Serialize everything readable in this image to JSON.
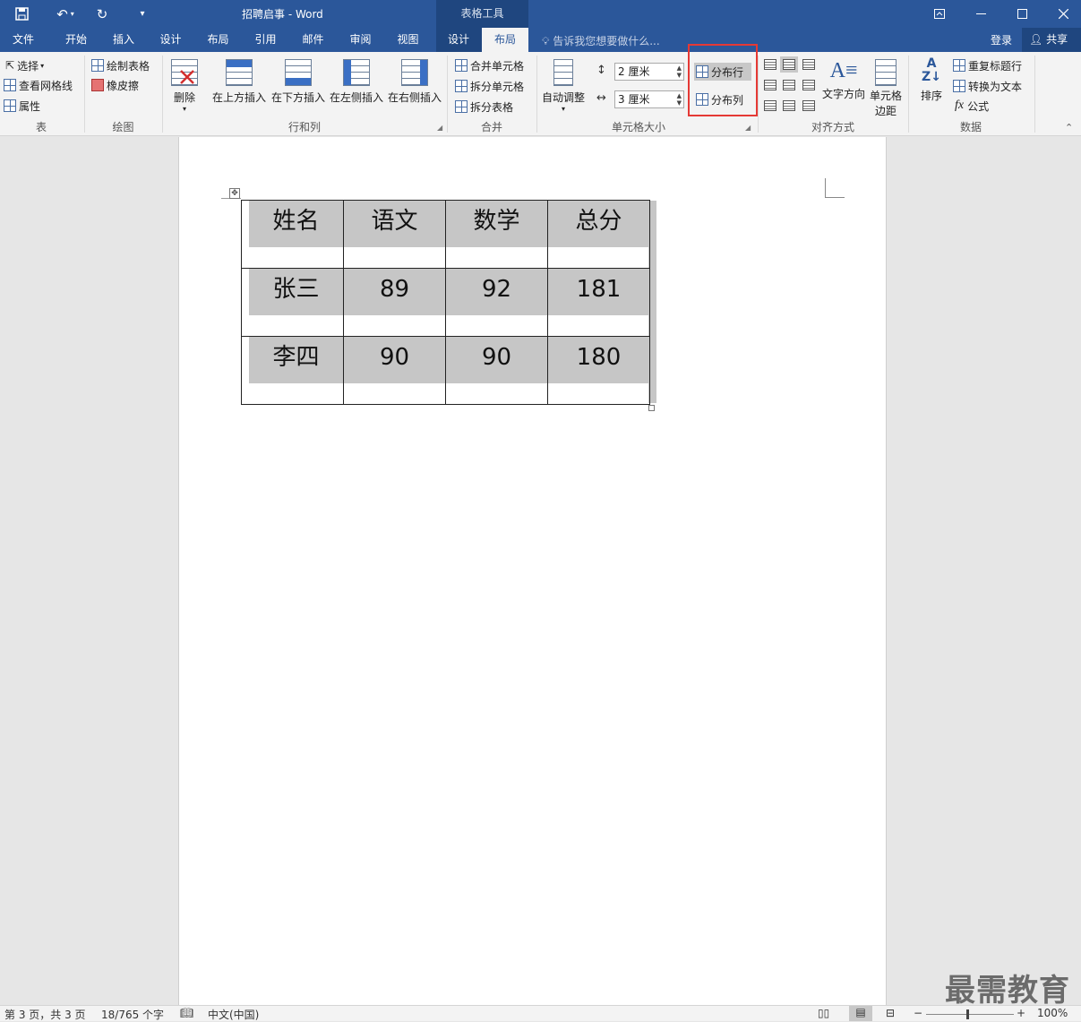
{
  "titlebar": {
    "doc_title": "招聘启事 - Word",
    "table_tools": "表格工具",
    "save_icon": "save-icon",
    "undo_icon": "undo-icon",
    "redo_icon": "redo-icon",
    "customize_icon": "customize-qat-icon"
  },
  "tabs": [
    "文件",
    "开始",
    "插入",
    "设计",
    "布局",
    "引用",
    "邮件",
    "审阅",
    "视图"
  ],
  "tool_tabs": [
    "设计",
    "布局"
  ],
  "tell_me": "告诉我您想要做什么...",
  "account": {
    "login": "登录",
    "share": "共享"
  },
  "ribbon": {
    "table": {
      "select": "选择",
      "gridlines": "查看网格线",
      "properties": "属性",
      "label": "表"
    },
    "draw": {
      "draw_table": "绘制表格",
      "eraser": "橡皮擦",
      "label": "绘图"
    },
    "rows_cols": {
      "delete": "删除",
      "insert_above": "在上方插入",
      "insert_below": "在下方插入",
      "insert_left": "在左侧插入",
      "insert_right": "在右侧插入",
      "label": "行和列"
    },
    "merge": {
      "merge_cells": "合并单元格",
      "split_cells": "拆分单元格",
      "split_table": "拆分表格",
      "label": "合并"
    },
    "cell_size": {
      "autofit": "自动调整",
      "height": "2 厘米",
      "width": "3 厘米",
      "distribute_rows": "分布行",
      "distribute_cols": "分布列",
      "label": "单元格大小"
    },
    "alignment": {
      "text_direction": "文字方向",
      "cell_margins_1": "单元格",
      "cell_margins_2": "边距",
      "label": "对齐方式"
    },
    "data": {
      "sort": "排序",
      "repeat_header": "重复标题行",
      "convert": "转换为文本",
      "formula": "公式",
      "label": "数据"
    }
  },
  "table": {
    "rows": [
      [
        "姓名",
        "语文",
        "数学",
        "总分"
      ],
      [
        "张三",
        "89",
        "92",
        "181"
      ],
      [
        "李四",
        "90",
        "90",
        "180"
      ]
    ]
  },
  "status": {
    "page": "第 3 页，共 3 页",
    "words": "18/765 个字",
    "lang": "中文(中国)",
    "zoom": "100%"
  },
  "watermark": "最需教育"
}
